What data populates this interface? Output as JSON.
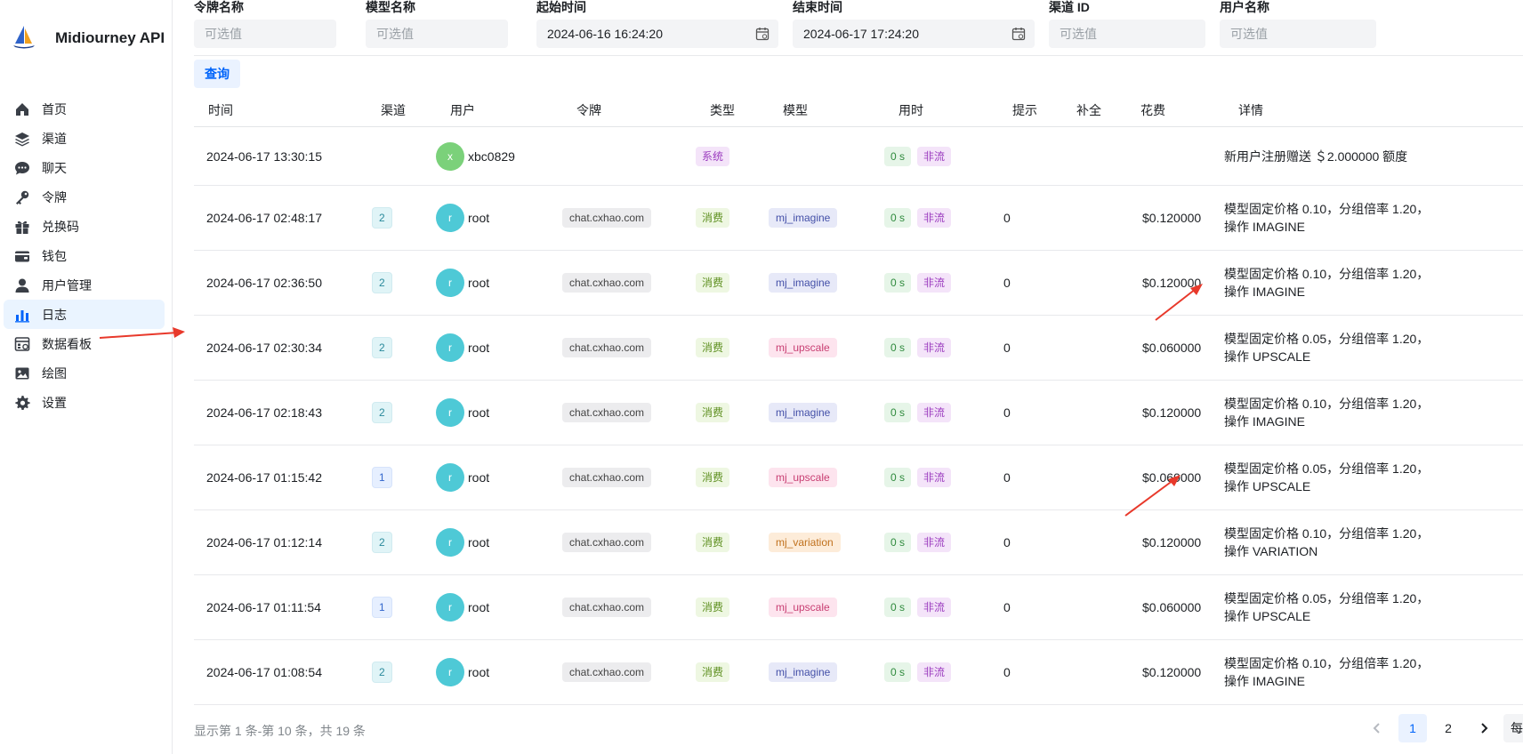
{
  "app": {
    "title": "Midiourney API"
  },
  "nav": [
    {
      "label": "首页",
      "icon": "home-icon",
      "key": "home"
    },
    {
      "label": "渠道",
      "icon": "layers-icon",
      "key": "channel"
    },
    {
      "label": "聊天",
      "icon": "chat-icon",
      "key": "chat"
    },
    {
      "label": "令牌",
      "icon": "key-icon",
      "key": "token"
    },
    {
      "label": "兑换码",
      "icon": "gift-icon",
      "key": "redeem"
    },
    {
      "label": "钱包",
      "icon": "wallet-icon",
      "key": "wallet"
    },
    {
      "label": "用户管理",
      "icon": "user-icon",
      "key": "users"
    },
    {
      "label": "日志",
      "icon": "bar-chart-icon",
      "key": "log",
      "active": true
    },
    {
      "label": "数据看板",
      "icon": "dashboard-icon",
      "key": "dashboard"
    },
    {
      "label": "绘图",
      "icon": "image-icon",
      "key": "drawing"
    },
    {
      "label": "设置",
      "icon": "gear-icon",
      "key": "settings"
    }
  ],
  "filters": {
    "token_name": {
      "label": "令牌名称",
      "placeholder": "可选值"
    },
    "model_name": {
      "label": "模型名称",
      "placeholder": "可选值"
    },
    "start_time": {
      "label": "起始时间",
      "value": "2024-06-16 16:24:20"
    },
    "end_time": {
      "label": "结束时间",
      "value": "2024-06-17 17:24:20"
    },
    "channel_id": {
      "label": "渠道 ID",
      "placeholder": "可选值"
    },
    "username": {
      "label": "用户名称",
      "placeholder": "可选值"
    }
  },
  "query_button": "查询",
  "table": {
    "columns": [
      "时间",
      "渠道",
      "用户",
      "令牌",
      "类型",
      "模型",
      "用时",
      "提示",
      "补全",
      "花费",
      "详情"
    ],
    "rows": [
      {
        "time": "2024-06-17 13:30:15",
        "channel": "",
        "avatar": "x",
        "avatar_color": "#7bd17a",
        "user": "xbc0829",
        "token": "",
        "type": "系统",
        "type_kind": "sys",
        "model": "",
        "model_kind": "",
        "duration": "0 s",
        "stream": "非流",
        "prompt": "",
        "completion": "",
        "cost": "",
        "detail_line1": "新用户注册赠送 ＄2.000000 额度",
        "detail_line2": ""
      },
      {
        "time": "2024-06-17 02:48:17",
        "channel": "2",
        "avatar": "r",
        "avatar_color": "#4ec9d6",
        "user": "root",
        "token": "chat.cxhao.com",
        "type": "消费",
        "type_kind": "cost",
        "model": "mj_imagine",
        "model_kind": "imagine",
        "duration": "0 s",
        "stream": "非流",
        "prompt": "0",
        "completion": "",
        "cost": "$0.120000",
        "detail_line1": "模型固定价格 0.10，分组倍率 1.20，",
        "detail_line2": "操作 IMAGINE"
      },
      {
        "time": "2024-06-17 02:36:50",
        "channel": "2",
        "avatar": "r",
        "avatar_color": "#4ec9d6",
        "user": "root",
        "token": "chat.cxhao.com",
        "type": "消费",
        "type_kind": "cost",
        "model": "mj_imagine",
        "model_kind": "imagine",
        "duration": "0 s",
        "stream": "非流",
        "prompt": "0",
        "completion": "",
        "cost": "$0.120000",
        "detail_line1": "模型固定价格 0.10，分组倍率 1.20，",
        "detail_line2": "操作 IMAGINE"
      },
      {
        "time": "2024-06-17 02:30:34",
        "channel": "2",
        "avatar": "r",
        "avatar_color": "#4ec9d6",
        "user": "root",
        "token": "chat.cxhao.com",
        "type": "消费",
        "type_kind": "cost",
        "model": "mj_upscale",
        "model_kind": "upscale",
        "duration": "0 s",
        "stream": "非流",
        "prompt": "0",
        "completion": "",
        "cost": "$0.060000",
        "detail_line1": "模型固定价格 0.05，分组倍率 1.20，",
        "detail_line2": "操作 UPSCALE"
      },
      {
        "time": "2024-06-17 02:18:43",
        "channel": "2",
        "avatar": "r",
        "avatar_color": "#4ec9d6",
        "user": "root",
        "token": "chat.cxhao.com",
        "type": "消费",
        "type_kind": "cost",
        "model": "mj_imagine",
        "model_kind": "imagine",
        "duration": "0 s",
        "stream": "非流",
        "prompt": "0",
        "completion": "",
        "cost": "$0.120000",
        "detail_line1": "模型固定价格 0.10，分组倍率 1.20，",
        "detail_line2": "操作 IMAGINE"
      },
      {
        "time": "2024-06-17 01:15:42",
        "channel": "1",
        "avatar": "r",
        "avatar_color": "#4ec9d6",
        "user": "root",
        "token": "chat.cxhao.com",
        "type": "消费",
        "type_kind": "cost",
        "model": "mj_upscale",
        "model_kind": "upscale",
        "duration": "0 s",
        "stream": "非流",
        "prompt": "0",
        "completion": "",
        "cost": "$0.060000",
        "detail_line1": "模型固定价格 0.05，分组倍率 1.20，",
        "detail_line2": "操作 UPSCALE"
      },
      {
        "time": "2024-06-17 01:12:14",
        "channel": "2",
        "avatar": "r",
        "avatar_color": "#4ec9d6",
        "user": "root",
        "token": "chat.cxhao.com",
        "type": "消费",
        "type_kind": "cost",
        "model": "mj_variation",
        "model_kind": "variation",
        "duration": "0 s",
        "stream": "非流",
        "prompt": "0",
        "completion": "",
        "cost": "$0.120000",
        "detail_line1": "模型固定价格 0.10，分组倍率 1.20，",
        "detail_line2": "操作 VARIATION"
      },
      {
        "time": "2024-06-17 01:11:54",
        "channel": "1",
        "avatar": "r",
        "avatar_color": "#4ec9d6",
        "user": "root",
        "token": "chat.cxhao.com",
        "type": "消费",
        "type_kind": "cost",
        "model": "mj_upscale",
        "model_kind": "upscale",
        "duration": "0 s",
        "stream": "非流",
        "prompt": "0",
        "completion": "",
        "cost": "$0.060000",
        "detail_line1": "模型固定价格 0.05，分组倍率 1.20，",
        "detail_line2": "操作 UPSCALE"
      },
      {
        "time": "2024-06-17 01:08:54",
        "channel": "2",
        "avatar": "r",
        "avatar_color": "#4ec9d6",
        "user": "root",
        "token": "chat.cxhao.com",
        "type": "消费",
        "type_kind": "cost",
        "model": "mj_imagine",
        "model_kind": "imagine",
        "duration": "0 s",
        "stream": "非流",
        "prompt": "0",
        "completion": "",
        "cost": "$0.120000",
        "detail_line1": "模型固定价格 0.10，分组倍率 1.20，",
        "detail_line2": "操作 IMAGINE"
      }
    ]
  },
  "footer": {
    "summary": "显示第 1 条-第 10 条，共 19 条",
    "pages": [
      "1",
      "2"
    ],
    "current_page": "1",
    "per_page_label": "每"
  },
  "colors": {
    "accent": "#0064fa",
    "active_nav_bg": "#eaf4ff",
    "annotation_arrow": "#e8392b"
  }
}
